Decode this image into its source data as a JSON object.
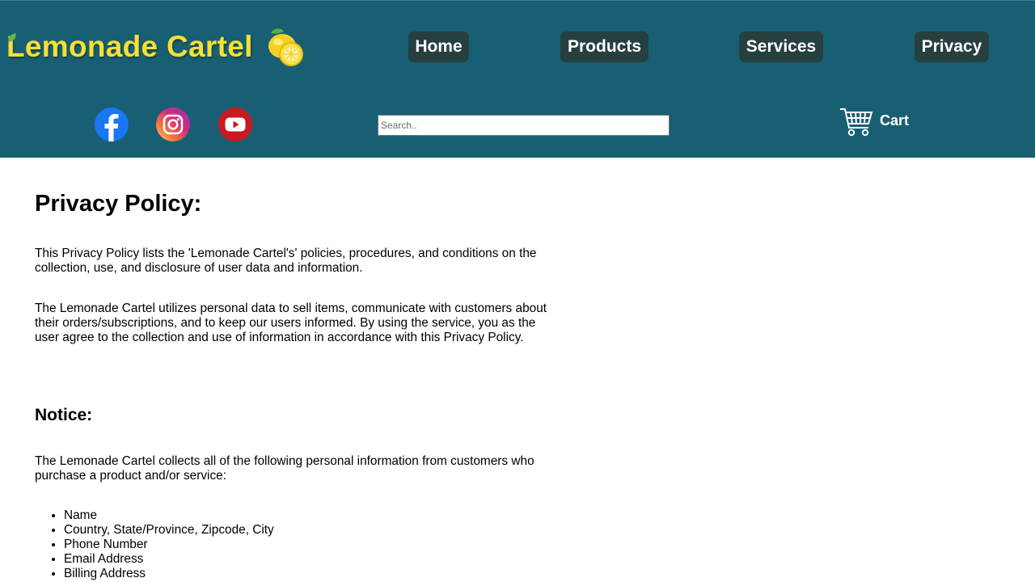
{
  "header": {
    "logo_text": "Lemonade Cartel",
    "nav": [
      {
        "label": "Home"
      },
      {
        "label": "Products"
      },
      {
        "label": "Services"
      },
      {
        "label": "Privacy"
      }
    ],
    "social": [
      {
        "name": "facebook-icon"
      },
      {
        "name": "instagram-icon"
      },
      {
        "name": "youtube-icon"
      }
    ],
    "search": {
      "placeholder": "Search..",
      "value": ""
    },
    "cart_label": "Cart",
    "colors": {
      "header_bg": "#185f74",
      "logo": "#f5e034",
      "nav_bg": "#25403f"
    }
  },
  "main": {
    "title": "Privacy Policy:",
    "para1": "This Privacy Policy lists the 'Lemonade Cartel's' policies, procedures, and conditions on the collection, use, and disclosure of user data and information.",
    "para2": "The Lemonade Cartel utilizes personal data to sell items, communicate with customers about their orders/subscriptions, and to keep our users informed. By using the service, you as the user agree to the collection and use of information in accordance with this Privacy Policy.",
    "notice_heading": "Notice:",
    "notice_text": "The Lemonade Cartel collects all of the following personal information from customers who purchase a product and/or service:",
    "items": [
      "Name",
      "Country, State/Province, Zipcode, City",
      "Phone Number",
      "Email Address",
      "Billing Address"
    ]
  }
}
